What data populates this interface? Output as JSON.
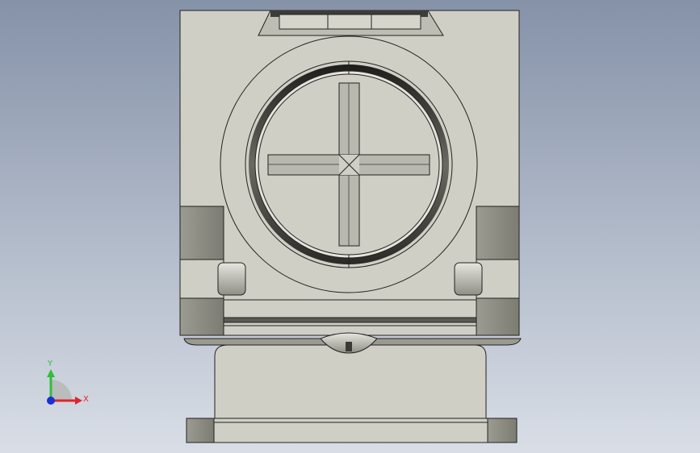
{
  "viewport": {
    "background_top": "#8592a8",
    "background_bottom": "#d9dee6"
  },
  "model": {
    "body_color": "#cfcfc5",
    "shadow_color": "#8c8c82",
    "dark_color": "#3a3a36",
    "edge_color": "#222222"
  },
  "triad": {
    "y_label": "Y",
    "x_label": "X",
    "y_color": "#2fbf3a",
    "x_color": "#e0242a",
    "z_color": "#1a2fd6"
  }
}
